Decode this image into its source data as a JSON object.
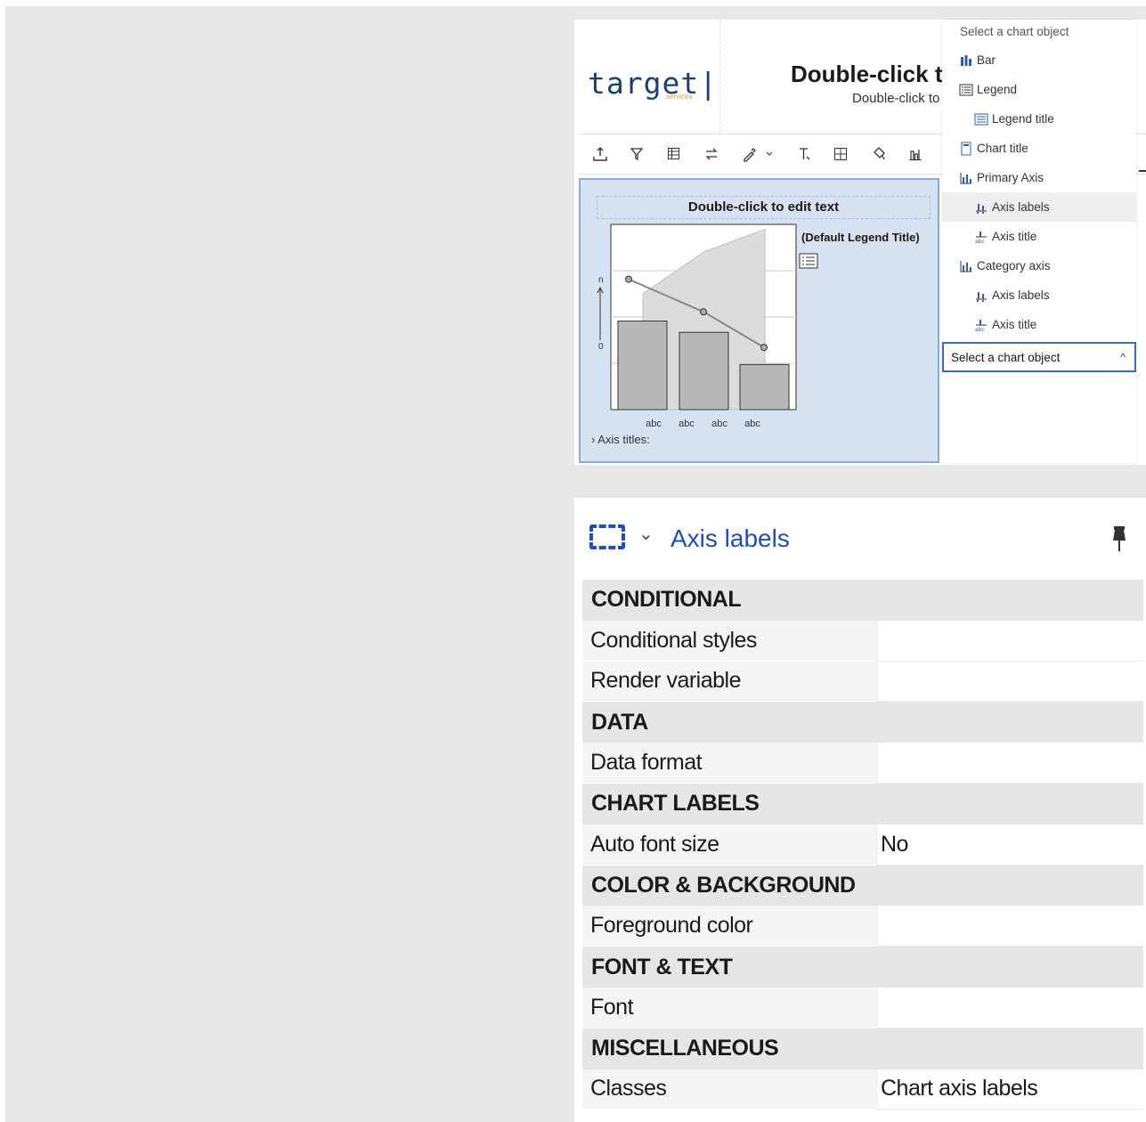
{
  "report": {
    "logo_text": "target",
    "logo_sub": "services",
    "title": "Double-click t",
    "subtitle": "Double-click to"
  },
  "toolbar": {
    "icons": [
      "export-icon",
      "filter-icon",
      "table-settings-icon",
      "swap-icon",
      "eyedropper-icon",
      "chevron-down-icon",
      "text-format-icon",
      "borders-icon",
      "paint-icon",
      "chart-icon"
    ]
  },
  "chart": {
    "title_placeholder": "Double-click to edit text",
    "legend_title": "(Default Legend Title)",
    "axis_titles_label": "› Axis titles:",
    "y_tick_top": "n",
    "y_tick_zero": "0",
    "categories_label": "abc",
    "chart_data": {
      "type": "bar",
      "categories": [
        "abc",
        "abc",
        "abc"
      ],
      "series": [
        {
          "values": [
            0.55,
            0.48,
            0.28
          ]
        },
        {
          "values": [
            0.88,
            0.66,
            0.42
          ]
        },
        {
          "values": [
            0.72,
            0.98,
            1.12
          ]
        }
      ],
      "extra_category": "abc",
      "y_ticks": [
        "n",
        "0"
      ]
    }
  },
  "dropdown": {
    "header": "Select a chart object",
    "items": [
      {
        "label": "Bar",
        "icon": "bar-chart-icon",
        "indent": 0,
        "selected": false
      },
      {
        "label": "Legend",
        "icon": "legend-icon",
        "indent": 0,
        "selected": false
      },
      {
        "label": "Legend title",
        "icon": "legend-title-icon",
        "indent": 1,
        "selected": false
      },
      {
        "label": "Chart title",
        "icon": "chart-title-icon",
        "indent": 0,
        "selected": false
      },
      {
        "label": "Primary Axis",
        "icon": "axis-icon",
        "indent": 0,
        "selected": false
      },
      {
        "label": "Axis labels",
        "icon": "axis-labels-icon",
        "indent": 1,
        "selected": true
      },
      {
        "label": "Axis title",
        "icon": "axis-title-icon",
        "indent": 1,
        "selected": false
      },
      {
        "label": "Category axis",
        "icon": "axis-icon",
        "indent": 0,
        "selected": false
      },
      {
        "label": "Axis labels",
        "icon": "axis-labels-icon",
        "indent": 1,
        "selected": false
      },
      {
        "label": "Axis title",
        "icon": "axis-title-icon",
        "indent": 1,
        "selected": false
      }
    ],
    "select_value": "Select a chart object"
  },
  "properties": {
    "title": "Axis labels",
    "rows": [
      {
        "type": "section",
        "label": "CONDITIONAL"
      },
      {
        "type": "prop",
        "label": "Conditional styles",
        "value": ""
      },
      {
        "type": "prop",
        "label": "Render variable",
        "value": ""
      },
      {
        "type": "section",
        "label": "DATA"
      },
      {
        "type": "prop",
        "label": "Data format",
        "value": ""
      },
      {
        "type": "section",
        "label": "CHART LABELS"
      },
      {
        "type": "prop",
        "label": "Auto font size",
        "value": "No"
      },
      {
        "type": "section",
        "label": "COLOR & BACKGROUND"
      },
      {
        "type": "prop",
        "label": "Foreground color",
        "value": ""
      },
      {
        "type": "section",
        "label": "FONT & TEXT"
      },
      {
        "type": "prop",
        "label": "Font",
        "value": ""
      },
      {
        "type": "section",
        "label": "MISCELLANEOUS"
      },
      {
        "type": "prop",
        "label": "Classes",
        "value": "Chart axis labels"
      }
    ]
  },
  "colors": {
    "accent": "#1f4fb5",
    "chart_bg": "#d6e2f2",
    "bar": "#b8b8b8",
    "area": "#dcdcdc"
  }
}
